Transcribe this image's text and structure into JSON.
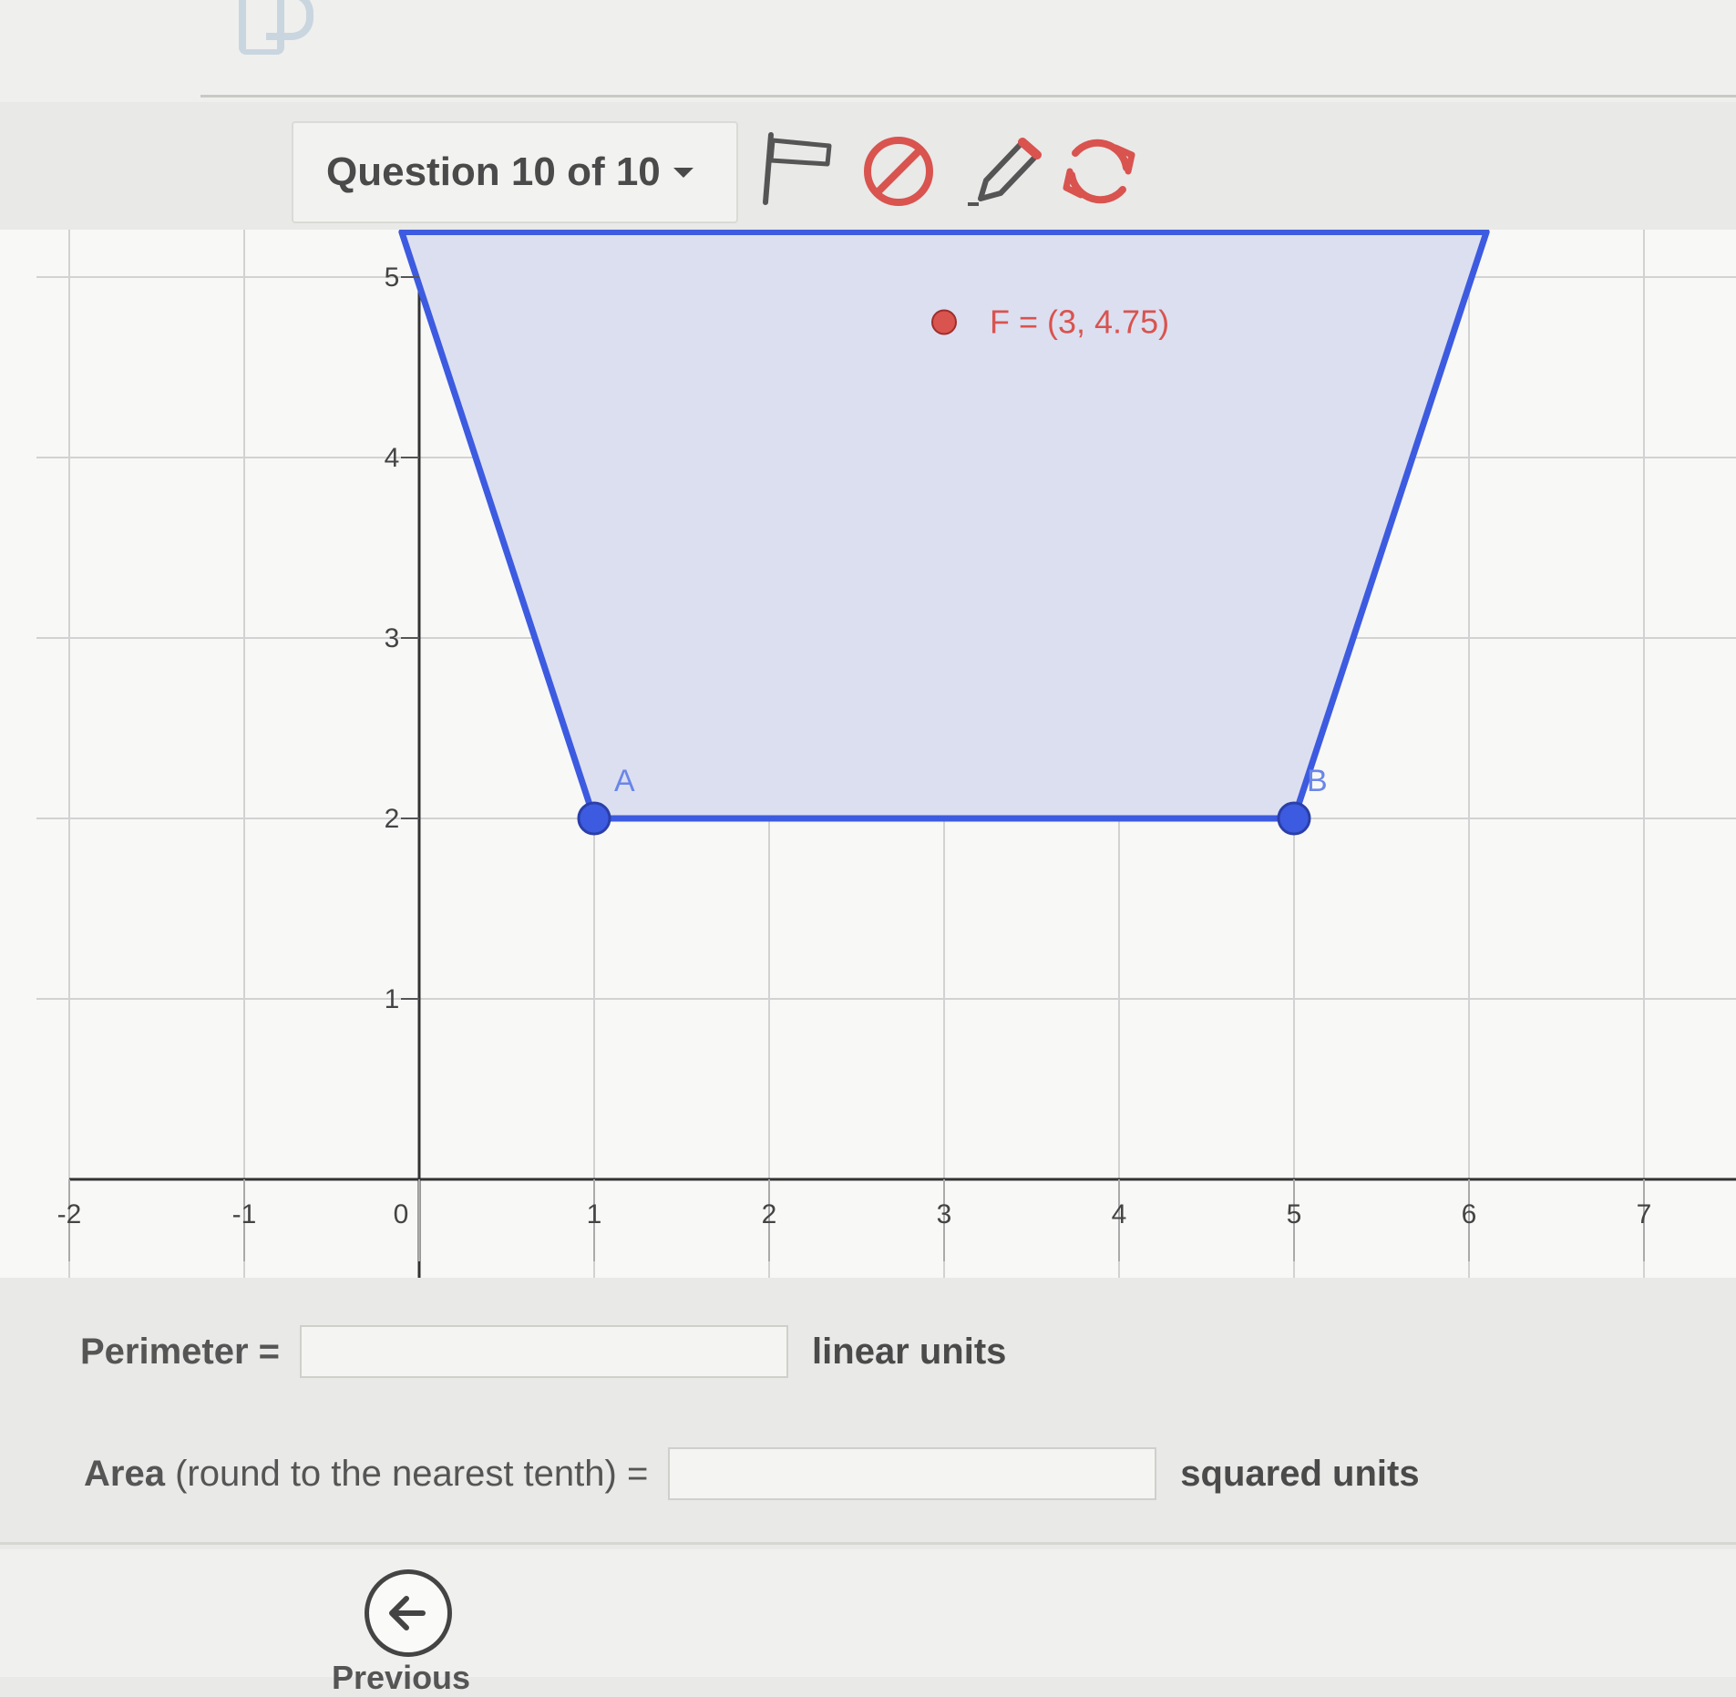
{
  "header": {
    "question_selector": "Question 10 of 10"
  },
  "toolbar": {
    "icons": [
      "flag-icon",
      "eliminate-icon",
      "pencil-icon",
      "reload-icon"
    ],
    "accent_color": "#d9534f"
  },
  "graph": {
    "x_ticks": [
      "-2",
      "-1",
      "0",
      "1",
      "2",
      "3",
      "4",
      "5",
      "6",
      "7"
    ],
    "y_ticks": [
      "1",
      "2",
      "3",
      "4",
      "5"
    ],
    "x_range": [
      -2,
      7
    ],
    "y_range": [
      0,
      5
    ],
    "shape_color": "#3d5be0",
    "fill_color": "#dcdff0",
    "points": {
      "A": {
        "label": "A",
        "x": 1,
        "y": 2
      },
      "B": {
        "label": "B",
        "x": 5,
        "y": 2
      },
      "F": {
        "label": "F = (3, 4.75)",
        "x": 3,
        "y": 4.75
      }
    },
    "polygon": [
      [
        -0.1,
        5.25
      ],
      [
        1,
        2
      ],
      [
        5,
        2
      ],
      [
        6.1,
        5.25
      ]
    ]
  },
  "answers": {
    "perimeter": {
      "label": "Perimeter =",
      "unit": "linear units",
      "value": ""
    },
    "area": {
      "label_main": "Area",
      "label_note": "(round to the nearest tenth) =",
      "unit": "squared units",
      "value": ""
    }
  },
  "footer": {
    "previous_label": "Previous"
  }
}
